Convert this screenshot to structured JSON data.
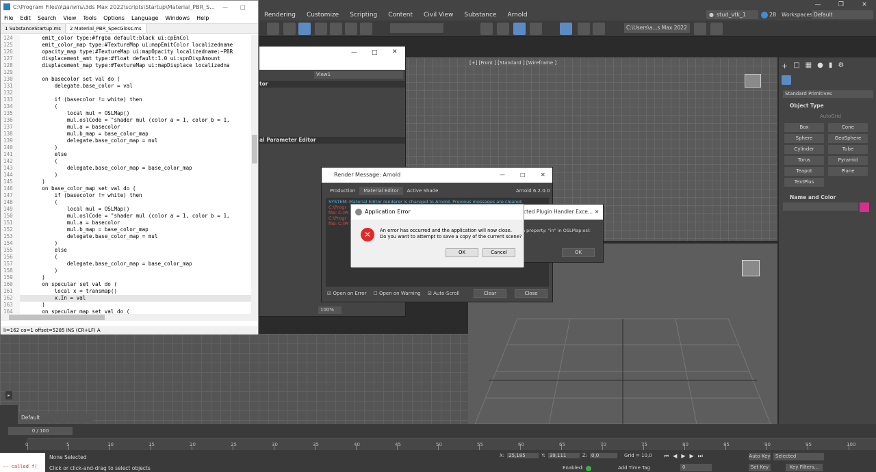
{
  "max": {
    "menu": [
      "Rendering",
      "Customize",
      "Scripting",
      "Content",
      "Civil View",
      "Substance",
      "Arnold"
    ],
    "user": "stud_vtk_1",
    "badge": "28",
    "workspaces_label": "Workspaces:",
    "workspace": "Default",
    "path_field": "C:\\Users\\a...s Max 2022",
    "viewport_label": "[+] [Front ] [Standard ] [Wireframe ]",
    "command_panel": {
      "dropdown": "Standard Primitives",
      "section1": "Object Type",
      "autogrid": "AutoGrid",
      "buttons": [
        "Box",
        "Cone",
        "Sphere",
        "GeoSphere",
        "Cylinder",
        "Tube",
        "Torus",
        "Pyramid",
        "Teapot",
        "Plane",
        "TextPlus"
      ],
      "section2": "Name and Color"
    },
    "layer": "Default",
    "time_slider": "0 / 100",
    "time_ticks": [
      "0",
      "5",
      "10",
      "15",
      "20",
      "25",
      "30",
      "35",
      "40",
      "45",
      "50",
      "55",
      "60",
      "65",
      "70",
      "75",
      "80",
      "85",
      "90",
      "95",
      "100"
    ],
    "status": {
      "selected": "None Selected",
      "hint": "Click or click-and-drag to select objects",
      "listener": "-- called f(",
      "x_label": "X:",
      "x": "25,185",
      "y_label": "Y:",
      "y": "39,111",
      "z_label": "Z:",
      "z": "0,0",
      "grid": "Grid = 10,0",
      "enabled": "Enabled:",
      "add_time_tag": "Add Time Tag",
      "auto_key": "Auto Key",
      "selected_dd": "Selected",
      "set_key": "Set Key",
      "key_filters": "Key Filters...",
      "frame": "0"
    }
  },
  "editor": {
    "title": "C:\\Program Files\\Удалить\\3ds Max 2022\\scripts\\Startup\\Material_PBR_S...",
    "menu": [
      "File",
      "Edit",
      "Search",
      "View",
      "Tools",
      "Options",
      "Language",
      "Windows",
      "Help"
    ],
    "tabs": [
      "1 SubstanceStartup.ms",
      "2 Material_PBR_SpecGloss.ms"
    ],
    "lines": [
      {
        "n": "124",
        "t": "    emit_color type:#frgba default:black ui:cpEmCol"
      },
      {
        "n": "125",
        "t": "    emit_color_map type:#TextureMap ui:mapEmitColor localizedname"
      },
      {
        "n": "126",
        "t": "    opacity_map type:#TextureMap ui:mapOpacity localizedname:~PBR"
      },
      {
        "n": "127",
        "t": "    displacement_amt type:#float default:1.0 ui:spnDispAmount"
      },
      {
        "n": "128",
        "t": "    displacement_map type:#TextureMap ui:mapDisplace localizedna"
      },
      {
        "n": "129",
        "t": ""
      },
      {
        "n": "130",
        "t": "    on basecolor set val do ("
      },
      {
        "n": "131",
        "t": "        delegate.base_color = val"
      },
      {
        "n": "132",
        "t": ""
      },
      {
        "n": "133",
        "t": "        if (basecolor != white) then"
      },
      {
        "n": "134",
        "t": "        ("
      },
      {
        "n": "135",
        "t": "            local mul = OSLMap()"
      },
      {
        "n": "136",
        "t": "            mul.oslCode = \"shader mul (color a = 1, color b = 1,"
      },
      {
        "n": "137",
        "t": "            mul.a = basecolor"
      },
      {
        "n": "138",
        "t": "            mul.b_map = base_color_map"
      },
      {
        "n": "139",
        "t": "            delegate.base_color_map = mul"
      },
      {
        "n": "140",
        "t": "        )"
      },
      {
        "n": "141",
        "t": "        else"
      },
      {
        "n": "142",
        "t": "        ("
      },
      {
        "n": "143",
        "t": "            delegate.base_color_map = base_color_map"
      },
      {
        "n": "144",
        "t": "        )"
      },
      {
        "n": "145",
        "t": "    )"
      },
      {
        "n": "146",
        "t": "    on base_color_map set val do ("
      },
      {
        "n": "147",
        "t": "        if (basecolor != white) then"
      },
      {
        "n": "148",
        "t": "        ("
      },
      {
        "n": "149",
        "t": "            local mul = OSLMap()"
      },
      {
        "n": "150",
        "t": "            mul.oslCode = \"shader mul (color a = 1, color b = 1,"
      },
      {
        "n": "151",
        "t": "            mul.a = basecolor"
      },
      {
        "n": "152",
        "t": "            mul.b_map = base_color_map"
      },
      {
        "n": "153",
        "t": "            delegate.base_color_map = mul"
      },
      {
        "n": "154",
        "t": "        )"
      },
      {
        "n": "155",
        "t": "        else"
      },
      {
        "n": "156",
        "t": "        ("
      },
      {
        "n": "157",
        "t": "            delegate.base_color_map = base_color_map"
      },
      {
        "n": "158",
        "t": "        )"
      },
      {
        "n": "159",
        "t": "    )"
      },
      {
        "n": "160",
        "t": "    on specular set val do ("
      },
      {
        "n": "161",
        "t": "        local x = transmap()"
      },
      {
        "n": "162",
        "t": "        x.In = val"
      },
      {
        "n": "163",
        "t": "    )"
      },
      {
        "n": "164",
        "t": "    on specular_map set val do ("
      }
    ],
    "status": "li=162 co=1 offset=5285 INS (CR+LF) A"
  },
  "slate": {
    "view": "View1",
    "panel1": "tor",
    "panel2": "al Parameter Editor",
    "zoom": "100%"
  },
  "render_msg": {
    "title": "Render Message: Arnold",
    "tabs": [
      "Production",
      "Material Editor",
      "Active Shade"
    ],
    "version": "Arnold 6.2.0.0",
    "system_line": "SYSTEM: Material Editor renderer is changed to Arnold. Previous messages are cleared.",
    "red_lines": [
      "C:\\Progr",
      "file: C:\\Pr",
      "C:\\Progr",
      "file: C:\\Pr"
    ],
    "open_on_error": "Open on Error",
    "open_on_warning": "Open on Warning",
    "auto_scroll": "Auto-Scroll",
    "clear": "Clear",
    "close": "Close"
  },
  "plugin_dlg": {
    "title": "cted Plugin Handler Exce...",
    "text": "n property: \"in\" in OSLMap:osl:",
    "ok": "OK"
  },
  "app_error": {
    "title": "Application Error",
    "line1": "An error has occurred and the application will now close.",
    "line2": "Do you want to attempt to save a copy of the current scene?",
    "ok": "OK",
    "cancel": "Cancel"
  }
}
